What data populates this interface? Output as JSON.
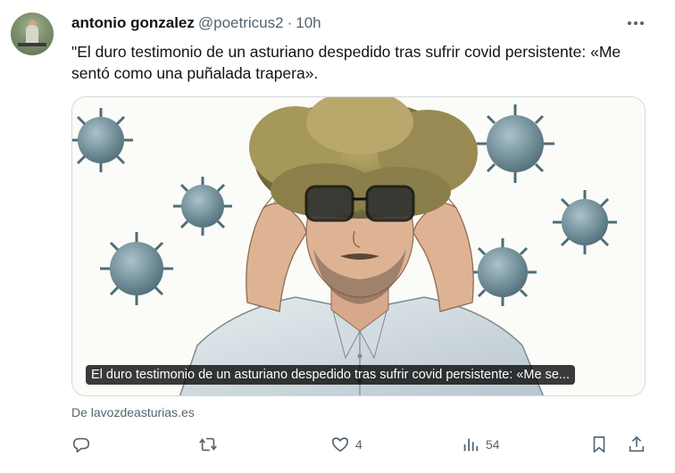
{
  "author": {
    "name": "antonio gonzalez",
    "handle": "@poetricus2",
    "separator": "·",
    "time": "10h"
  },
  "tweet_text": "\"El duro testimonio de un asturiano despedido tras sufrir covid persistente: «Me sentó como una puñalada trapera».",
  "card": {
    "caption": "El duro testimonio de un asturiano despedido tras sufrir covid persistente: «Me se...",
    "source": "De lavozdeasturias.es"
  },
  "actions": {
    "reply_icon": "reply-icon",
    "retweet_icon": "retweet-icon",
    "like_icon": "heart-icon",
    "like_count": "4",
    "views_icon": "views-icon",
    "views_count": "54",
    "bookmark_icon": "bookmark-icon",
    "share_icon": "share-icon"
  },
  "colors": {
    "text_primary": "#0f1419",
    "text_secondary": "#536471",
    "border": "#cfd9de",
    "virus": "#6f8c96",
    "cloud": "#9b8e58"
  }
}
